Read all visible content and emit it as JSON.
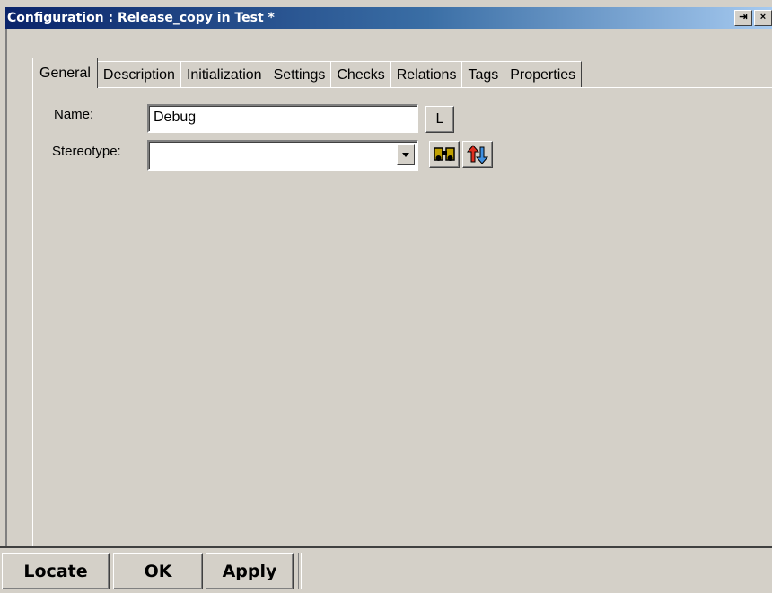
{
  "window": {
    "title": "Configuration : Release_copy in Test *",
    "buttons": {
      "pin": "⇥",
      "close": "×"
    }
  },
  "tabs": [
    {
      "label": "General",
      "active": true
    },
    {
      "label": "Description"
    },
    {
      "label": "Initialization"
    },
    {
      "label": "Settings"
    },
    {
      "label": "Checks"
    },
    {
      "label": "Relations"
    },
    {
      "label": "Tags"
    },
    {
      "label": "Properties"
    }
  ],
  "general": {
    "name_label": "Name:",
    "name_value": "Debug",
    "name_button": "L",
    "stereotype_label": "Stereotype:",
    "stereotype_value": "",
    "icons": [
      "binoculars-icon",
      "arrows-swap-icon"
    ]
  },
  "bottom": {
    "locate": "Locate",
    "ok": "OK",
    "apply": "Apply"
  }
}
